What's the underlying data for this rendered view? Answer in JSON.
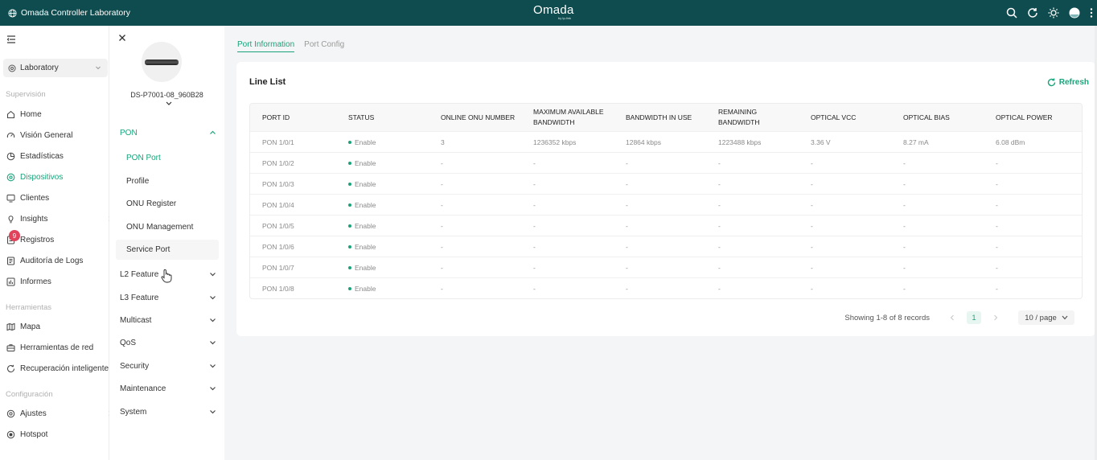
{
  "topbar": {
    "org_name": "Omada Controller Laboratory",
    "brand": "Omada",
    "brand_sub": "by tp-link"
  },
  "nav": {
    "site": "Laboratory",
    "sections": {
      "supervision": "Supervisión",
      "tools": "Herramientas",
      "config": "Configuración"
    },
    "items": {
      "home": "Home",
      "overview": "Visión General",
      "stats": "Estadísticas",
      "devices": "Dispositivos",
      "clients": "Clientes",
      "insights": "Insights",
      "logs": "Registros",
      "audit": "Auditoría de Logs",
      "reports": "Informes",
      "map": "Mapa",
      "net_tools": "Herramientas de red",
      "recovery": "Recuperación inteligente",
      "settings": "Ajustes",
      "hotspot": "Hotspot"
    },
    "logs_badge": "9"
  },
  "device": {
    "name": "DS-P7001-08_960B28",
    "groups": {
      "pon": "PON",
      "l2": "L2 Feature",
      "l3": "L3 Feature",
      "multicast": "Multicast",
      "qos": "QoS",
      "security": "Security",
      "maintenance": "Maintenance",
      "system": "System"
    },
    "pon_items": {
      "pon_port": "PON Port",
      "profile": "Profile",
      "onu_register": "ONU Register",
      "onu_management": "ONU Management",
      "service_port": "Service Port"
    }
  },
  "tabs": {
    "port_info": "Port Information",
    "port_config": "Port Config"
  },
  "card": {
    "title": "Line List",
    "refresh": "Refresh"
  },
  "table": {
    "headers": [
      "PORT ID",
      "STATUS",
      "ONLINE ONU NUMBER",
      "MAXIMUM AVAILABLE BANDWIDTH",
      "BANDWIDTH IN USE",
      "REMAINING BANDWIDTH",
      "OPTICAL VCC",
      "OPTICAL BIAS",
      "OPTICAL POWER"
    ],
    "rows": [
      [
        "PON 1/0/1",
        "Enable",
        "3",
        "1236352 kbps",
        "12864 kbps",
        "1223488 kbps",
        "3.36 V",
        "8.27 mA",
        "6.08 dBm"
      ],
      [
        "PON 1/0/2",
        "Enable",
        "-",
        "-",
        "-",
        "-",
        "-",
        "-",
        "-"
      ],
      [
        "PON 1/0/3",
        "Enable",
        "-",
        "-",
        "-",
        "-",
        "-",
        "-",
        "-"
      ],
      [
        "PON 1/0/4",
        "Enable",
        "-",
        "-",
        "-",
        "-",
        "-",
        "-",
        "-"
      ],
      [
        "PON 1/0/5",
        "Enable",
        "-",
        "-",
        "-",
        "-",
        "-",
        "-",
        "-"
      ],
      [
        "PON 1/0/6",
        "Enable",
        "-",
        "-",
        "-",
        "-",
        "-",
        "-",
        "-"
      ],
      [
        "PON 1/0/7",
        "Enable",
        "-",
        "-",
        "-",
        "-",
        "-",
        "-",
        "-"
      ],
      [
        "PON 1/0/8",
        "Enable",
        "-",
        "-",
        "-",
        "-",
        "-",
        "-",
        "-"
      ]
    ]
  },
  "pagination": {
    "info": "Showing 1-8 of 8 records",
    "current_page": "1",
    "page_size": "10 / page"
  },
  "colors": {
    "topbar": "#0f4c4f",
    "accent": "#1aa37a",
    "badge": "#e0435a"
  }
}
